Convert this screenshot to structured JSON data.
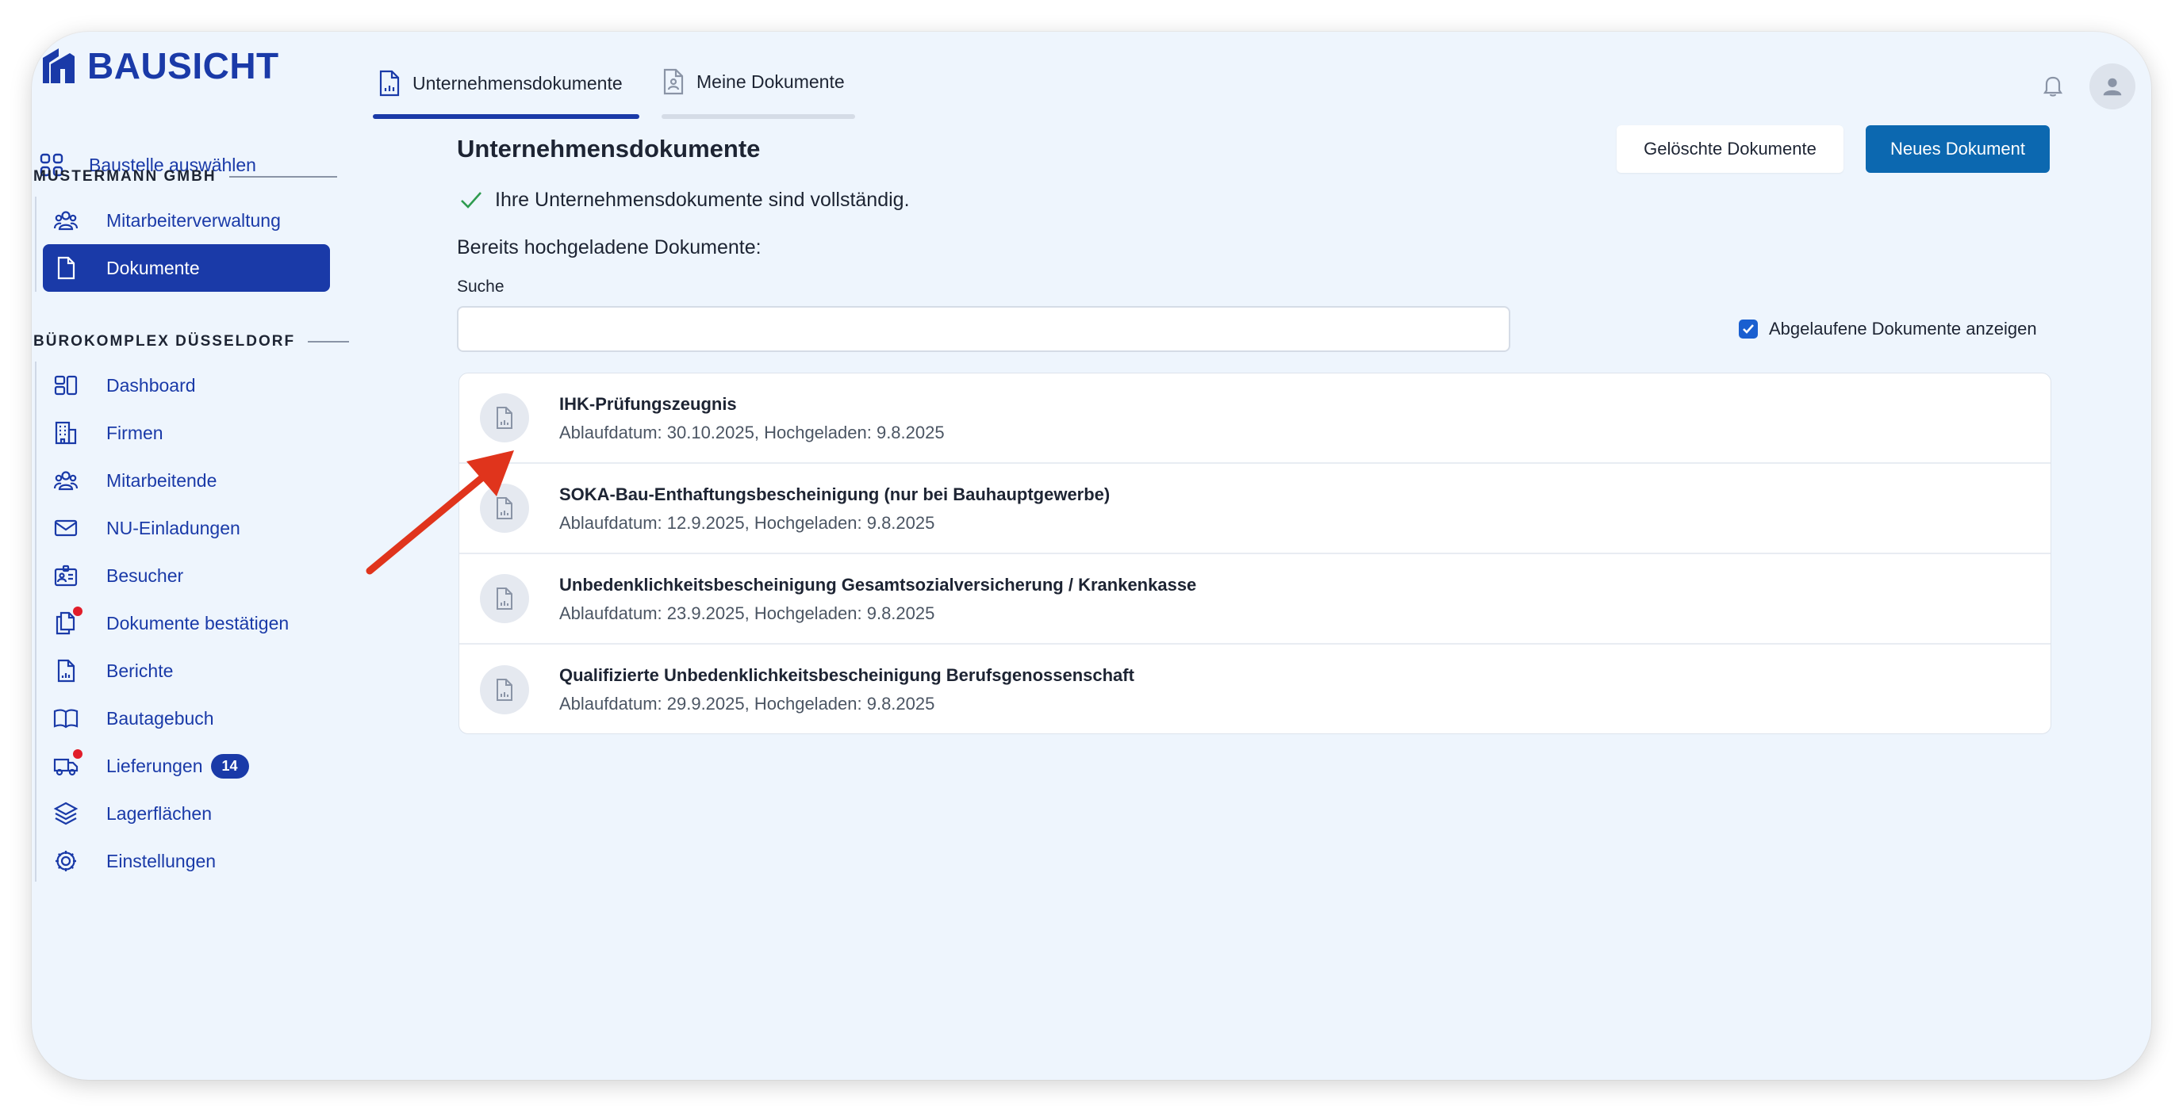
{
  "app": {
    "brand": "BAUSICHT"
  },
  "tabs": [
    {
      "label": "Unternehmensdokumente",
      "active": true
    },
    {
      "label": "Meine Dokumente",
      "active": false
    }
  ],
  "sidebar": {
    "select_site": "Baustelle auswählen",
    "group1": {
      "title": "MUSTERMANN GMBH",
      "items": [
        {
          "label": "Mitarbeiterverwaltung",
          "icon": "users-icon"
        },
        {
          "label": "Dokumente",
          "icon": "document-icon",
          "active": true
        }
      ]
    },
    "group2": {
      "title": "BÜROKOMPLEX DÜSSELDORF",
      "items": [
        {
          "label": "Dashboard",
          "icon": "dashboard-icon"
        },
        {
          "label": "Firmen",
          "icon": "building-icon"
        },
        {
          "label": "Mitarbeitende",
          "icon": "users-icon"
        },
        {
          "label": "NU-Einladungen",
          "icon": "envelope-icon"
        },
        {
          "label": "Besucher",
          "icon": "id-card-icon"
        },
        {
          "label": "Dokumente bestätigen",
          "icon": "documents-icon",
          "notification": true
        },
        {
          "label": "Berichte",
          "icon": "report-icon"
        },
        {
          "label": "Bautagebuch",
          "icon": "book-icon"
        },
        {
          "label": "Lieferungen",
          "icon": "truck-icon",
          "notification": true,
          "badge": "14"
        },
        {
          "label": "Lagerflächen",
          "icon": "layers-icon"
        },
        {
          "label": "Einstellungen",
          "icon": "gear-icon"
        }
      ]
    }
  },
  "header": {
    "bell_icon": "bell-icon",
    "avatar_icon": "user-icon"
  },
  "main": {
    "title": "Unternehmensdokumente",
    "deleted_button": "Gelöschte Dokumente",
    "new_button": "Neues Dokument",
    "success_message": "Ihre Unternehmensdokumente sind vollständig.",
    "uploaded_label": "Bereits hochgeladene Dokumente:",
    "search": {
      "label": "Suche",
      "value": "",
      "placeholder": ""
    },
    "show_expired": {
      "label": "Abgelaufene Dokumente anzeigen",
      "checked": true
    },
    "documents": [
      {
        "title": "IHK-Prüfungszeugnis",
        "meta": "Ablaufdatum: 30.10.2025, Hochgeladen: 9.8.2025"
      },
      {
        "title": "SOKA-Bau-Enthaftungsbescheinigung (nur bei Bauhauptgewerbe)",
        "meta": "Ablaufdatum: 12.9.2025, Hochgeladen: 9.8.2025"
      },
      {
        "title": "Unbedenklichkeitsbescheinigung Gesamtsozialversicherung / Krankenkasse",
        "meta": "Ablaufdatum: 23.9.2025, Hochgeladen: 9.8.2025"
      },
      {
        "title": "Qualifizierte Unbedenklichkeitsbescheinigung Berufsgenossenschaft",
        "meta": "Ablaufdatum: 29.9.2025, Hochgeladen: 9.8.2025"
      }
    ]
  },
  "colors": {
    "brand": "#1a3aa8",
    "primary_button": "#0c68b0",
    "success": "#2e9b4f",
    "notification": "#e11d2a",
    "annotation_arrow": "#e0341c"
  }
}
